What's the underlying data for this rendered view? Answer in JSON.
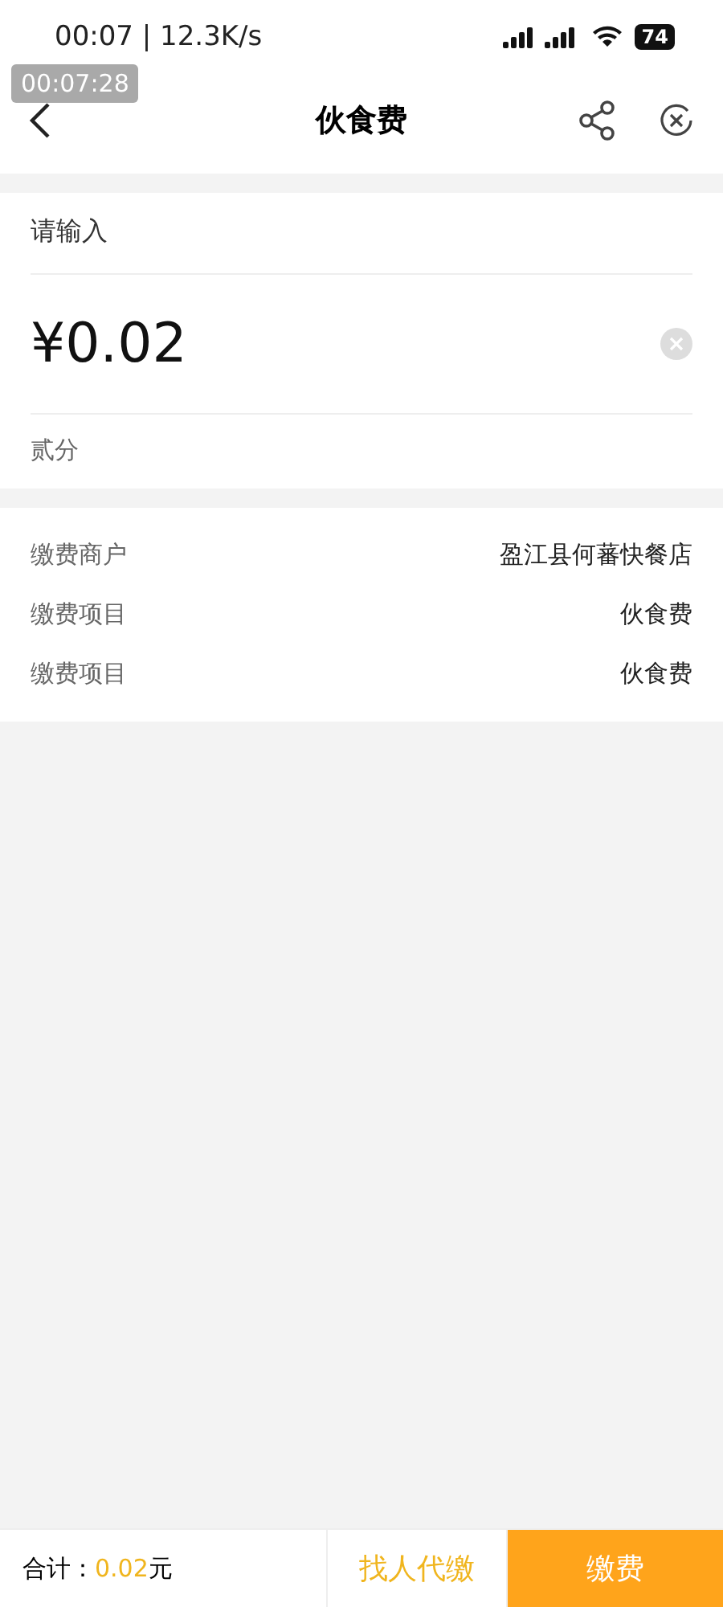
{
  "status_bar": {
    "time": "00:07",
    "separator": "|",
    "speed": "12.3K/s",
    "battery": "74"
  },
  "recording_badge": "00:07:28",
  "nav": {
    "title": "伙食费"
  },
  "amount": {
    "label": "请输入",
    "value": "¥0.02",
    "in_words": "贰分"
  },
  "details": [
    {
      "label": "缴费商户",
      "value": "盈江县何蕃快餐店"
    },
    {
      "label": "缴费项目",
      "value": "伙食费"
    },
    {
      "label": "缴费项目",
      "value": "伙食费"
    }
  ],
  "footer": {
    "total_label": "合计：",
    "total_value": "0.02",
    "unit": "元",
    "buttons": [
      {
        "label": "找人代缴",
        "kind": "secondary"
      },
      {
        "label": "缴费",
        "kind": "primary"
      }
    ]
  }
}
